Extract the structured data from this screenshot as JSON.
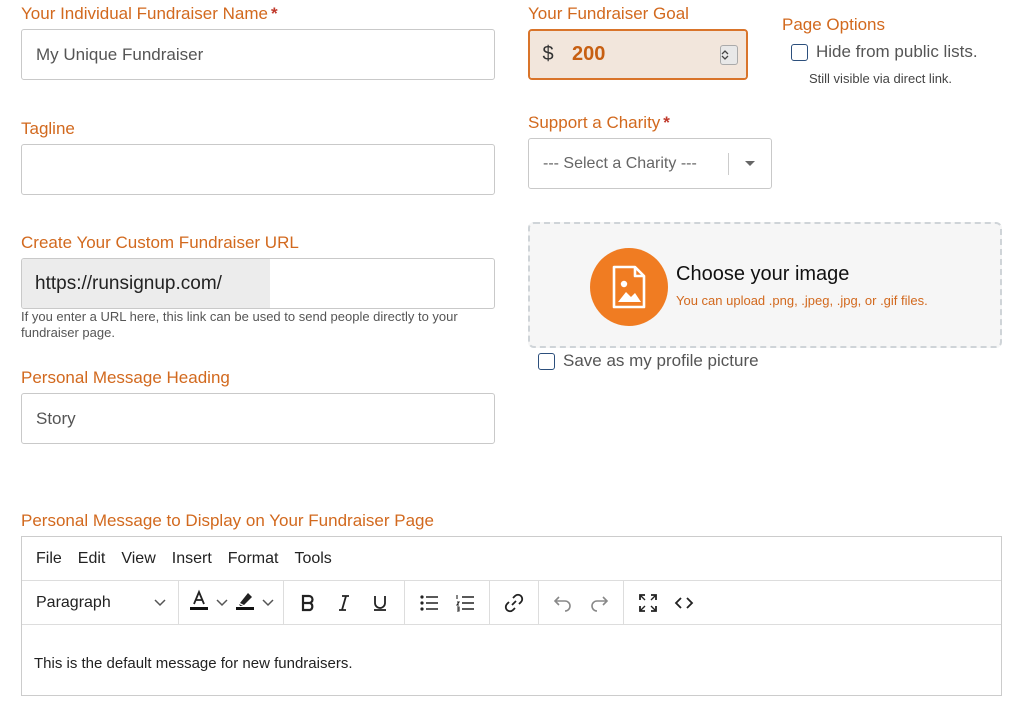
{
  "fields": {
    "fundraiser_name": {
      "label": "Your Individual Fundraiser Name",
      "value": "My Unique Fundraiser"
    },
    "tagline": {
      "label": "Tagline",
      "value": ""
    },
    "custom_url": {
      "label": "Create Your Custom Fundraiser URL",
      "prefix": "https://runsignup.com/",
      "value": "",
      "help": "If you enter a URL here, this link can be used to send people directly to your fundraiser page."
    },
    "message_heading": {
      "label": "Personal Message Heading",
      "value": "Story"
    }
  },
  "required_marker": "*",
  "goal": {
    "label": "Your Fundraiser Goal",
    "currency": "$",
    "value": "200"
  },
  "page_options": {
    "label": "Page Options",
    "hide_checkbox_label": "Hide from public lists.",
    "hide_checked": false,
    "hide_note": "Still visible via direct link."
  },
  "charity": {
    "label": "Support a Charity",
    "selected": "--- Select a Charity ---"
  },
  "image_upload": {
    "title": "Choose your image",
    "subtitle": "You can upload .png, .jpeg, .jpg, or .gif files.",
    "profile_checkbox_label": "Save as my profile picture",
    "profile_checked": false
  },
  "editor": {
    "label": "Personal Message to Display on Your Fundraiser Page",
    "menu": [
      "File",
      "Edit",
      "View",
      "Insert",
      "Format",
      "Tools"
    ],
    "block_format": "Paragraph",
    "content": "This is the default message for new fundraisers."
  },
  "colors": {
    "accent": "#d2691e",
    "upload_circle": "#f07c22"
  }
}
